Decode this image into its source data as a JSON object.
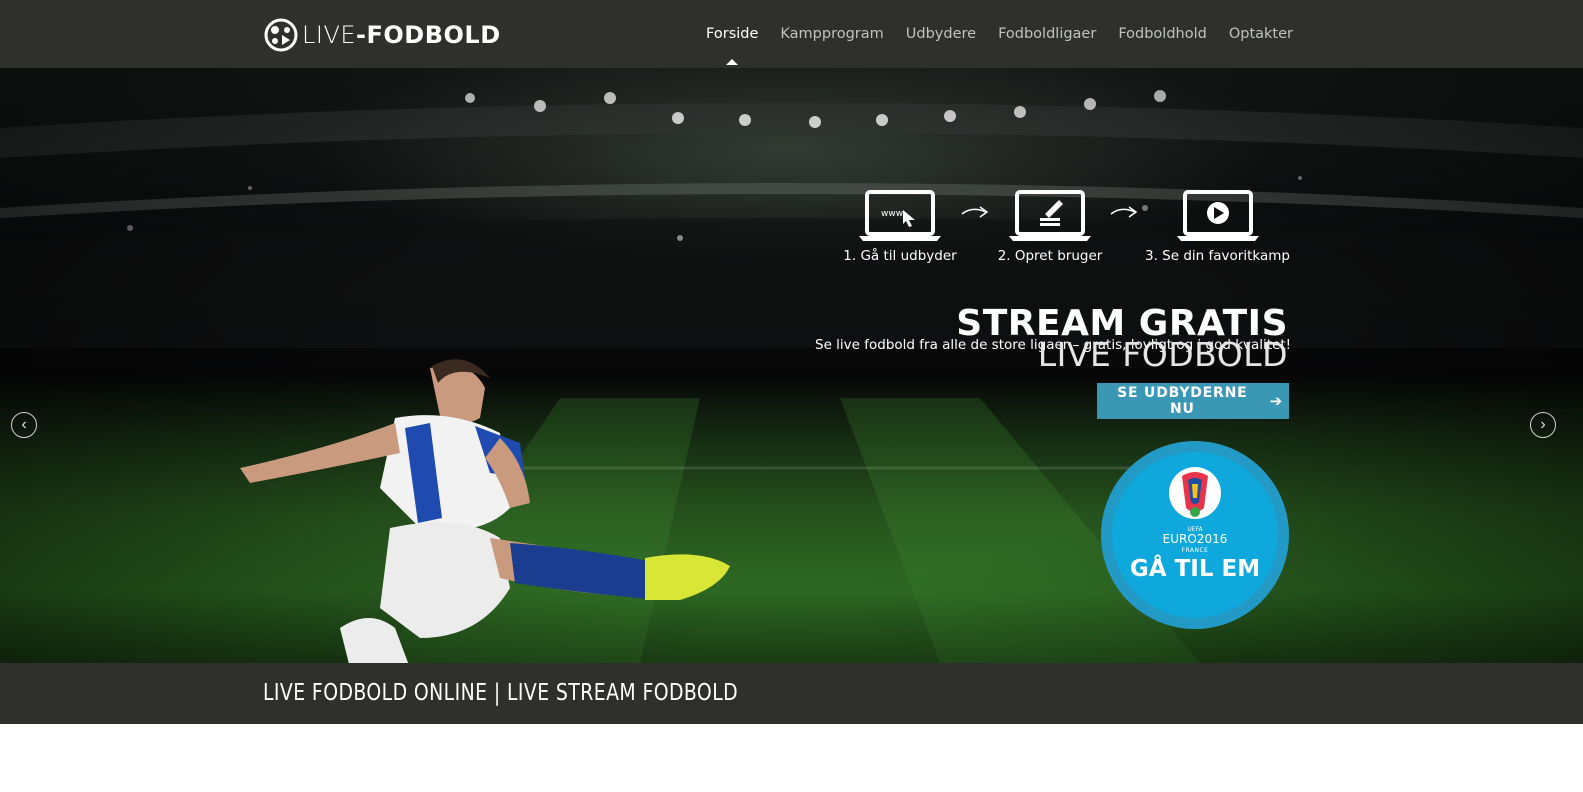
{
  "header": {
    "logo_part1": "LIVE",
    "logo_sep": "-",
    "logo_part2": "FODBOLD",
    "nav": [
      {
        "label": "Forside",
        "active": true
      },
      {
        "label": "Kampprogram"
      },
      {
        "label": "Udbydere"
      },
      {
        "label": "Fodboldligaer"
      },
      {
        "label": "Fodboldhold"
      },
      {
        "label": "Optakter"
      }
    ]
  },
  "hero": {
    "steps": [
      {
        "label": "1. Gå til udbyder",
        "icon": "browser-cursor-icon"
      },
      {
        "label": "2. Opret bruger",
        "icon": "pencil-form-icon"
      },
      {
        "label": "3. Se din favoritkamp",
        "icon": "play-icon"
      }
    ],
    "tagline": "Se live fodbold fra alle de store ligaer – gratis, lovligt og i god kvalitet!",
    "headline_1": "STREAM GRATIS",
    "headline_2": "LIVE FODBOLD",
    "cta_label": "SE UDBYDERNE NU",
    "em": {
      "uefa": "UEFA",
      "euro": "EURO2016",
      "france": "FRANCE",
      "cta": "GÅ TIL EM"
    },
    "slider_prev_icon": "chevron-left-icon",
    "slider_next_icon": "chevron-right-icon"
  },
  "page_title": "LIVE FODBOLD ONLINE | LIVE STREAM FODBOLD",
  "colors": {
    "header_bg": "#2f302d",
    "cta_bg": "#3b98b4",
    "em_badge": "#0ea8dc"
  }
}
